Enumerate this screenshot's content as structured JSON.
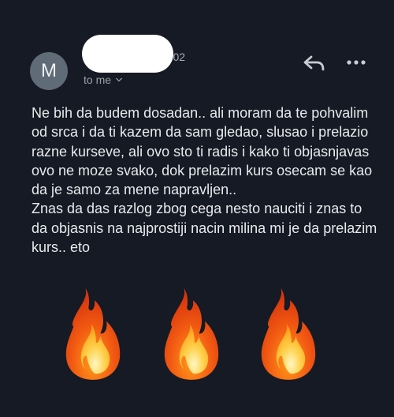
{
  "sender": {
    "avatar_initial": "M",
    "time": "14:02",
    "recipient": "to me"
  },
  "icons": {
    "recipient_toggle": "chevron-down-icon",
    "reply": "reply-icon",
    "more": "more-horizontal-icon"
  },
  "message": {
    "paragraph_1": "Ne bih da budem dosadan.. ali moram da te pohvalim od srca i da ti kazem da sam gledao, slusao i prelazio razne kurseve, ali ovo sto ti radis i kako ti objasnjavas ovo ne moze svako, dok prelazim kurs osecam se kao da je samo za mene napravljen..",
    "paragraph_2": "Znas da das razlog zbog cega nesto nauciti i znas to da objasnis na najprostiji nacin milina mi je da prelazim kurs.. eto",
    "emojis": [
      "fire",
      "fire",
      "fire"
    ]
  },
  "colors": {
    "background": "#161a24",
    "avatar": "#5f6b76",
    "text": "#e8eaed",
    "muted": "#9aa0a8"
  }
}
